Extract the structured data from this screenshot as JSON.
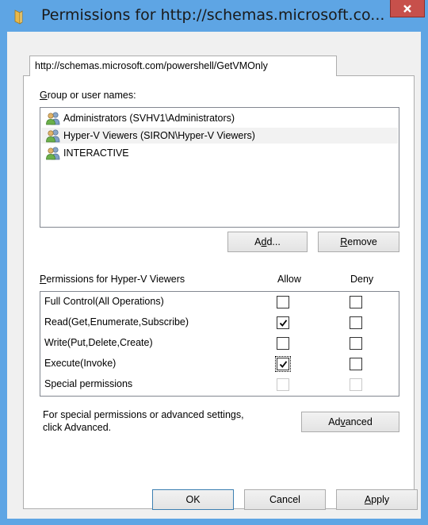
{
  "window": {
    "title": "Permissions for http://schemas.microsoft.co...",
    "close_icon": "close-icon"
  },
  "tab": {
    "label": "http://schemas.microsoft.com/powershell/GetVMOnly"
  },
  "groups": {
    "label": "Group or user names:",
    "items": [
      {
        "name": "Administrators (SVHV1\\Administrators)",
        "icon": "user-group-icon",
        "selected": false
      },
      {
        "name": "Hyper-V Viewers (SIRON\\Hyper-V Viewers)",
        "icon": "user-group-icon",
        "selected": true
      },
      {
        "name": "INTERACTIVE",
        "icon": "user-group-icon",
        "selected": false
      }
    ]
  },
  "buttons": {
    "add": "Add...",
    "remove": "Remove",
    "advanced": "Advanced",
    "ok": "OK",
    "cancel": "Cancel",
    "apply": "Apply"
  },
  "permissions": {
    "header": "Permissions for Hyper-V Viewers",
    "allow_header": "Allow",
    "deny_header": "Deny",
    "rows": [
      {
        "name": "Full Control(All Operations)",
        "allow": false,
        "deny": false,
        "enabled": true
      },
      {
        "name": "Read(Get,Enumerate,Subscribe)",
        "allow": true,
        "deny": false,
        "enabled": true
      },
      {
        "name": "Write(Put,Delete,Create)",
        "allow": false,
        "deny": false,
        "enabled": true
      },
      {
        "name": "Execute(Invoke)",
        "allow": true,
        "deny": false,
        "enabled": true,
        "focused": true
      },
      {
        "name": "Special permissions",
        "allow": false,
        "deny": false,
        "enabled": false
      }
    ]
  },
  "advanced_note": {
    "line1": "For special permissions or advanced settings,",
    "line2": "click Advanced."
  }
}
